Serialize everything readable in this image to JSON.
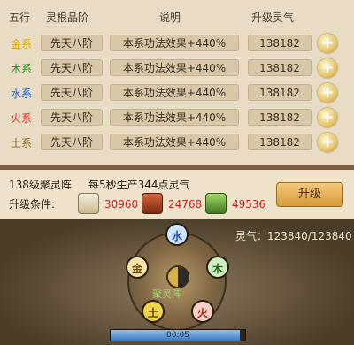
{
  "headers": {
    "element": "五行",
    "grade": "灵根品阶",
    "desc": "说明",
    "qi": "升级灵气"
  },
  "rows": [
    {
      "element": "金系",
      "grade": "先天八阶",
      "desc": "本系功法效果+440%",
      "cost": "138182",
      "color": "#d9a400"
    },
    {
      "element": "木系",
      "grade": "先天八阶",
      "desc": "本系功法效果+440%",
      "cost": "138182",
      "color": "#2f8f1e"
    },
    {
      "element": "水系",
      "grade": "先天八阶",
      "desc": "本系功法效果+440%",
      "cost": "138182",
      "color": "#2062c8"
    },
    {
      "element": "火系",
      "grade": "先天八阶",
      "desc": "本系功法效果+440%",
      "cost": "138182",
      "color": "#d02a1a"
    },
    {
      "element": "土系",
      "grade": "先天八阶",
      "desc": "本系功法效果+440%",
      "cost": "138182",
      "color": "#8a6a2a"
    }
  ],
  "array_info": {
    "level_text": "138级聚灵阵",
    "production_text": "每5秒生产344点灵气",
    "upgrade_label": "升级条件:",
    "resources": [
      {
        "icon": "scroll-icon",
        "value": "30960"
      },
      {
        "icon": "chest-icon",
        "value": "24768"
      },
      {
        "icon": "herb-icon",
        "value": "49536"
      }
    ],
    "upgrade_button": "升级"
  },
  "qi_display": "灵气：123840/123840",
  "wheel": {
    "nodes": [
      {
        "label": "水",
        "name": "water-node"
      },
      {
        "label": "木",
        "name": "wood-node"
      },
      {
        "label": "火",
        "name": "fire-node"
      },
      {
        "label": "土",
        "name": "earth-node"
      },
      {
        "label": "金",
        "name": "metal-node"
      }
    ],
    "center_label": "聚灵阵"
  },
  "progress": {
    "text": "00:05",
    "fraction": 0.96
  }
}
